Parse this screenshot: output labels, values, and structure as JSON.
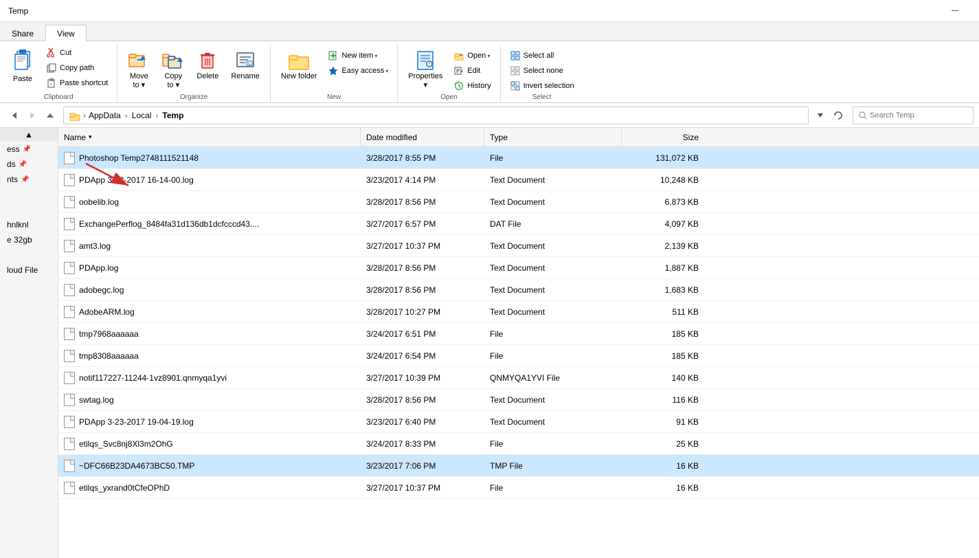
{
  "titleBar": {
    "title": "Temp",
    "minimizeLabel": "—"
  },
  "tabs": [
    {
      "id": "share",
      "label": "Share"
    },
    {
      "id": "view",
      "label": "View"
    }
  ],
  "ribbon": {
    "groups": [
      {
        "id": "clipboard",
        "label": "Clipboard",
        "buttons": [
          {
            "id": "paste",
            "label": "Paste",
            "type": "large"
          },
          {
            "id": "cut",
            "label": "Cut",
            "type": "small"
          },
          {
            "id": "copy-path",
            "label": "Copy path",
            "type": "small"
          },
          {
            "id": "paste-shortcut",
            "label": "Paste shortcut",
            "type": "small"
          }
        ]
      },
      {
        "id": "organize",
        "label": "Organize",
        "buttons": [
          {
            "id": "move-to",
            "label": "Move to",
            "type": "large",
            "dropdown": true
          },
          {
            "id": "copy-to",
            "label": "Copy to",
            "type": "large",
            "dropdown": true
          },
          {
            "id": "delete",
            "label": "Delete",
            "type": "large"
          },
          {
            "id": "rename",
            "label": "Rename",
            "type": "large"
          }
        ]
      },
      {
        "id": "new",
        "label": "New",
        "buttons": [
          {
            "id": "new-folder",
            "label": "New folder",
            "type": "large"
          },
          {
            "id": "new-item",
            "label": "New item",
            "type": "large",
            "dropdown": true
          },
          {
            "id": "easy-access",
            "label": "Easy access",
            "type": "small",
            "dropdown": true
          }
        ]
      },
      {
        "id": "open",
        "label": "Open",
        "buttons": [
          {
            "id": "properties",
            "label": "Properties",
            "type": "large",
            "dropdown": true
          },
          {
            "id": "open",
            "label": "Open",
            "type": "small",
            "dropdown": true
          },
          {
            "id": "edit",
            "label": "Edit",
            "type": "small"
          },
          {
            "id": "history",
            "label": "History",
            "type": "small"
          }
        ]
      },
      {
        "id": "select",
        "label": "Select",
        "buttons": [
          {
            "id": "select-all",
            "label": "Select all",
            "type": "small"
          },
          {
            "id": "select-none",
            "label": "Select none",
            "type": "small"
          },
          {
            "id": "invert-selection",
            "label": "Invert selection",
            "type": "small"
          }
        ]
      }
    ]
  },
  "addressBar": {
    "breadcrumb": [
      "AppData",
      "Local",
      "Temp"
    ],
    "searchPlaceholder": "Search Temp"
  },
  "columnHeaders": {
    "name": "Name",
    "dateModified": "Date modified",
    "type": "Type",
    "size": "Size"
  },
  "files": [
    {
      "name": "Photoshop Temp2748111521148",
      "dateModified": "3/28/2017 8:55 PM",
      "type": "File",
      "size": "131,072 KB",
      "selected": true
    },
    {
      "name": "PDApp 3-23-2017 16-14-00.log",
      "dateModified": "3/23/2017 4:14 PM",
      "type": "Text Document",
      "size": "10,248 KB",
      "selected": false
    },
    {
      "name": "oobelib.log",
      "dateModified": "3/28/2017 8:56 PM",
      "type": "Text Document",
      "size": "6,873 KB",
      "selected": false
    },
    {
      "name": "ExchangePerflog_8484fa31d136db1dcfcccd43....",
      "dateModified": "3/27/2017 6:57 PM",
      "type": "DAT File",
      "size": "4,097 KB",
      "selected": false
    },
    {
      "name": "amt3.log",
      "dateModified": "3/27/2017 10:37 PM",
      "type": "Text Document",
      "size": "2,139 KB",
      "selected": false
    },
    {
      "name": "PDApp.log",
      "dateModified": "3/28/2017 8:56 PM",
      "type": "Text Document",
      "size": "1,887 KB",
      "selected": false
    },
    {
      "name": "adobegc.log",
      "dateModified": "3/28/2017 8:56 PM",
      "type": "Text Document",
      "size": "1,683 KB",
      "selected": false
    },
    {
      "name": "AdobeARM.log",
      "dateModified": "3/28/2017 10:27 PM",
      "type": "Text Document",
      "size": "511 KB",
      "selected": false
    },
    {
      "name": "tmp7968aaaaaa",
      "dateModified": "3/24/2017 6:51 PM",
      "type": "File",
      "size": "185 KB",
      "selected": false
    },
    {
      "name": "tmp8308aaaaaa",
      "dateModified": "3/24/2017 6:54 PM",
      "type": "File",
      "size": "185 KB",
      "selected": false
    },
    {
      "name": "notif117227-11244-1vz8901.qnmyqa1yvi",
      "dateModified": "3/27/2017 10:39 PM",
      "type": "QNMYQA1YVI File",
      "size": "140 KB",
      "selected": false
    },
    {
      "name": "swtag.log",
      "dateModified": "3/28/2017 8:56 PM",
      "type": "Text Document",
      "size": "116 KB",
      "selected": false
    },
    {
      "name": "PDApp 3-23-2017 19-04-19.log",
      "dateModified": "3/23/2017 6:40 PM",
      "type": "Text Document",
      "size": "91 KB",
      "selected": false
    },
    {
      "name": "etilqs_Svc8nj8Xl3m2OhG",
      "dateModified": "3/24/2017 8:33 PM",
      "type": "File",
      "size": "25 KB",
      "selected": false
    },
    {
      "name": "~DFC66B23DA4673BC50.TMP",
      "dateModified": "3/23/2017 7:06 PM",
      "type": "TMP File",
      "size": "16 KB",
      "selected": true
    },
    {
      "name": "etilqs_yxrand0tCfeOPhD",
      "dateModified": "3/27/2017 10:37 PM",
      "type": "File",
      "size": "16 KB",
      "selected": false
    }
  ],
  "sidebar": {
    "scrollUp": "▲",
    "items": [
      {
        "id": "ess",
        "label": "ess",
        "pinned": true
      },
      {
        "id": "ds",
        "label": "ds",
        "pinned": true
      },
      {
        "id": "nts",
        "label": "nts",
        "pinned": true
      },
      {
        "id": "blank1",
        "label": "",
        "pinned": false
      },
      {
        "id": "blank2",
        "label": "",
        "pinned": false
      },
      {
        "id": "hnlknl",
        "label": "hnlknl",
        "pinned": false
      },
      {
        "id": "e32gb",
        "label": "e 32gb",
        "pinned": false
      },
      {
        "id": "blank3",
        "label": "",
        "pinned": false
      },
      {
        "id": "loud-file",
        "label": "loud File",
        "pinned": false
      }
    ]
  }
}
